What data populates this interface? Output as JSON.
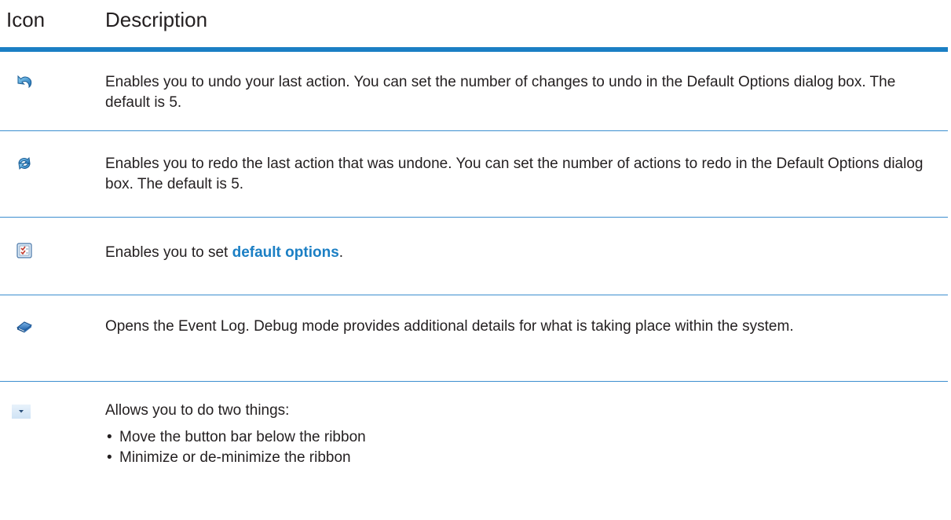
{
  "header": {
    "icon_label": "Icon",
    "description_label": "Description"
  },
  "rows": [
    {
      "icon": "undo-icon",
      "description": "Enables you to undo your last action. You can set the number of changes to undo in the Default Options dialog box. The default is 5."
    },
    {
      "icon": "redo-icon",
      "description": "Enables you to redo the last action that was undone. You can set the number of actions to redo in the Default Options dialog box. The default is 5."
    },
    {
      "icon": "default-options-icon",
      "description_prefix": "Enables you to set ",
      "link_text": "default options",
      "description_suffix": "."
    },
    {
      "icon": "event-log-icon",
      "description": "Opens the Event Log. Debug mode provides additional details for what is taking place within the system."
    },
    {
      "icon": "dropdown-arrow-icon",
      "description": "Allows you to do two things:",
      "bullets": [
        "Move the button bar below the ribbon",
        "Minimize or de-minimize the ribbon"
      ]
    }
  ],
  "colors": {
    "accent": "#1b7fc4",
    "rule": "#3c8ecf",
    "text": "#231f20"
  }
}
